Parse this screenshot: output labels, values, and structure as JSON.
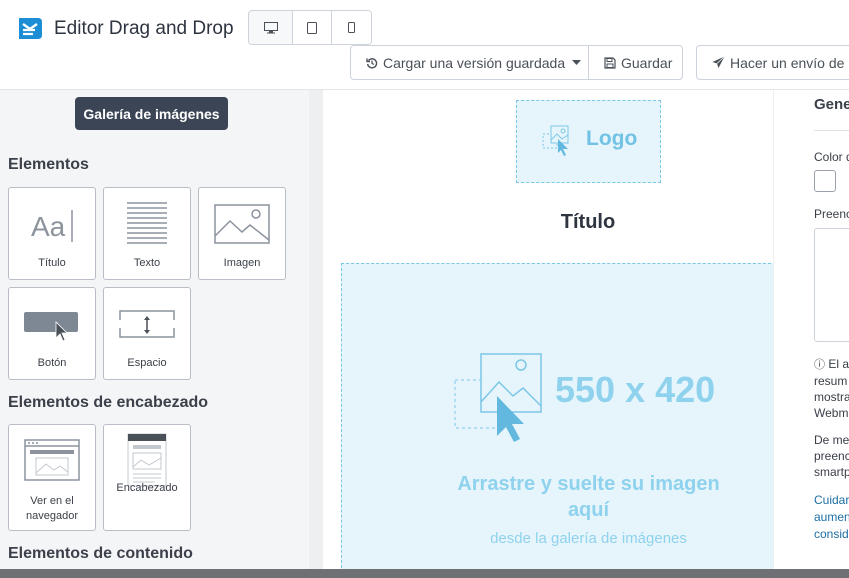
{
  "header": {
    "app_title": "Editor Drag and Drop",
    "devices": [
      {
        "name": "desktop-icon",
        "active": true
      },
      {
        "name": "tablet-icon",
        "active": false
      },
      {
        "name": "mobile-icon",
        "active": false
      }
    ],
    "load_version_label": "Cargar una versión guardada",
    "save_label": "Guardar",
    "send_label": "Hacer un envío de p"
  },
  "left_panel": {
    "gallery_button": "Galería de imágenes",
    "sections": {
      "elements": "Elementos",
      "header_elements": "Elementos de encabezado",
      "content_elements": "Elementos de contenido"
    },
    "elements": [
      {
        "label": "Título",
        "icon": "title-icon"
      },
      {
        "label": "Texto",
        "icon": "text-icon"
      },
      {
        "label": "Imagen",
        "icon": "image-icon"
      },
      {
        "label": "Botón",
        "icon": "button-icon"
      },
      {
        "label": "Espacio",
        "icon": "spacer-icon"
      }
    ],
    "header_elements": [
      {
        "label_line1": "Ver en el",
        "label_line2": "navegador",
        "icon": "browser-icon"
      },
      {
        "label": "Encabezado",
        "icon": "header-icon"
      }
    ]
  },
  "canvas": {
    "logo_placeholder": "Logo",
    "title": "Título",
    "image_dimensions": "550 x 420",
    "drop_text_line1": "Arrastre y suelte su imagen",
    "drop_text_line2": "aquí",
    "drop_subtext": "desde la galería de imágenes"
  },
  "right_panel": {
    "heading": "Gene",
    "color_label": "Color d",
    "preheader_label": "Preenc",
    "info_lines": [
      "El ar",
      "resum",
      "mostra",
      "Webm"
    ],
    "info2_lines": [
      "De me",
      "preenc",
      "smartp"
    ],
    "link_lines": [
      "Cuidar",
      "aumen",
      "consid"
    ]
  },
  "colors": {
    "accent_blue": "#1d8ed6",
    "dark_button": "#3b4556",
    "placeholder_bg": "#e6f5fb",
    "placeholder_text": "#8fd2ee"
  }
}
